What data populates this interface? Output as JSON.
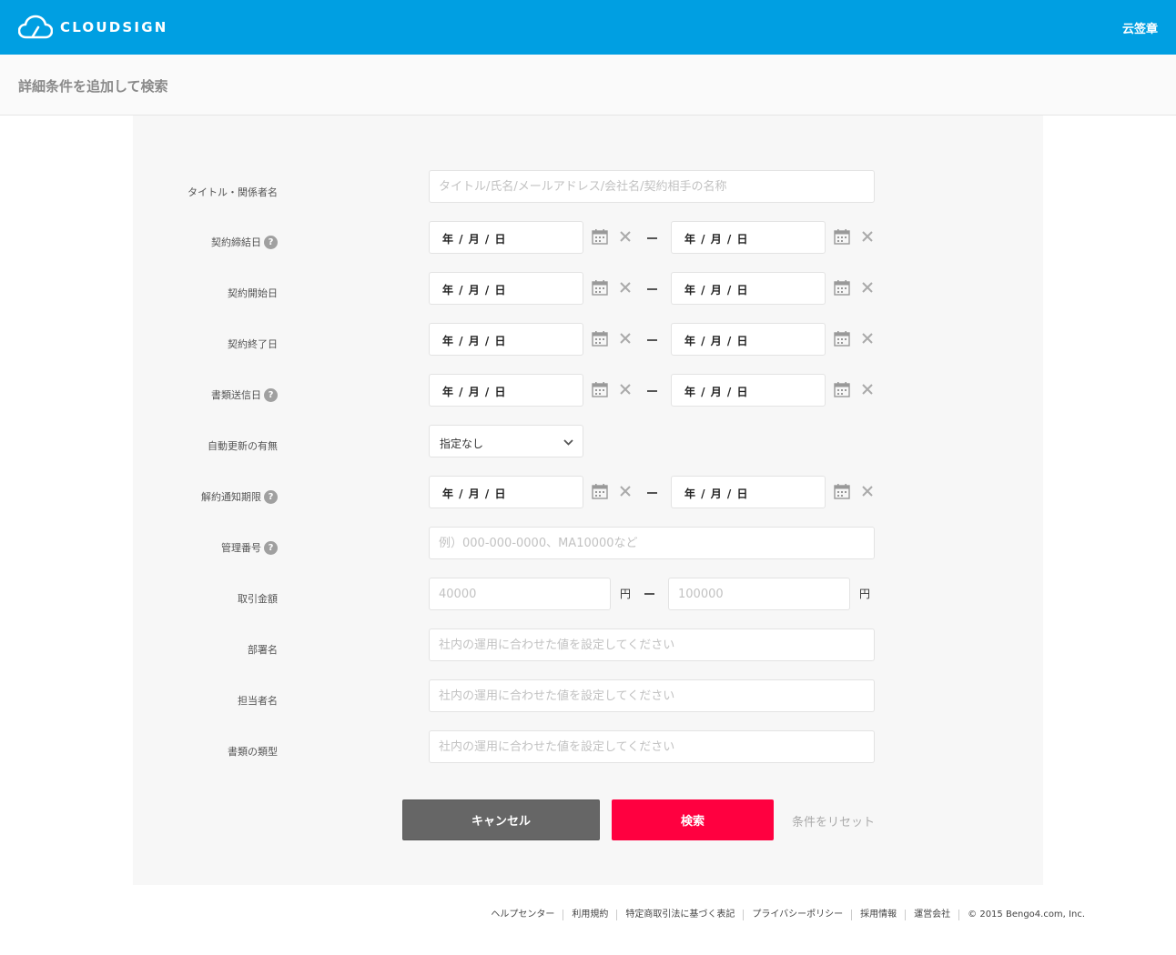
{
  "header": {
    "logo_text": "CLOUDSIGN",
    "user_name": "云签章",
    "brand_color": "#009fe2"
  },
  "page": {
    "title": "詳細条件を追加して検索"
  },
  "form": {
    "title_field": {
      "label": "タイトル・関係者名",
      "placeholder": "タイトル/氏名/メールアドレス/会社名/契約相手の名称"
    },
    "date_placeholder": "年 / 月 / 日",
    "contract_date": {
      "label": "契約締結日",
      "help": "?"
    },
    "start_date": {
      "label": "契約開始日"
    },
    "end_date": {
      "label": "契約終了日"
    },
    "sent_date": {
      "label": "書類送信日",
      "help": "?"
    },
    "auto_renew": {
      "label": "自動更新の有無",
      "selected": "指定なし"
    },
    "cancel_notice": {
      "label": "解約通知期限",
      "help": "?"
    },
    "management_no": {
      "label": "管理番号",
      "help": "?",
      "placeholder": "例）000-000-0000、MA10000など"
    },
    "amount": {
      "label": "取引金額",
      "min_placeholder": "40000",
      "max_placeholder": "100000",
      "unit": "円"
    },
    "department": {
      "label": "部署名",
      "placeholder": "社内の運用に合わせた値を設定してください"
    },
    "person": {
      "label": "担当者名",
      "placeholder": "社内の運用に合わせた値を設定してください"
    },
    "doc_type": {
      "label": "書類の類型",
      "placeholder": "社内の運用に合わせた値を設定してください"
    }
  },
  "buttons": {
    "cancel": "キャンセル",
    "search": "検索",
    "reset": "条件をリセット",
    "search_color": "#ff0040"
  },
  "footer": {
    "links": [
      "ヘルプセンター",
      "利用規約",
      "特定商取引法に基づく表記",
      "プライバシーポリシー",
      "採用情報",
      "運営会社"
    ],
    "copyright": "© 2015 Bengo4.com, Inc."
  }
}
